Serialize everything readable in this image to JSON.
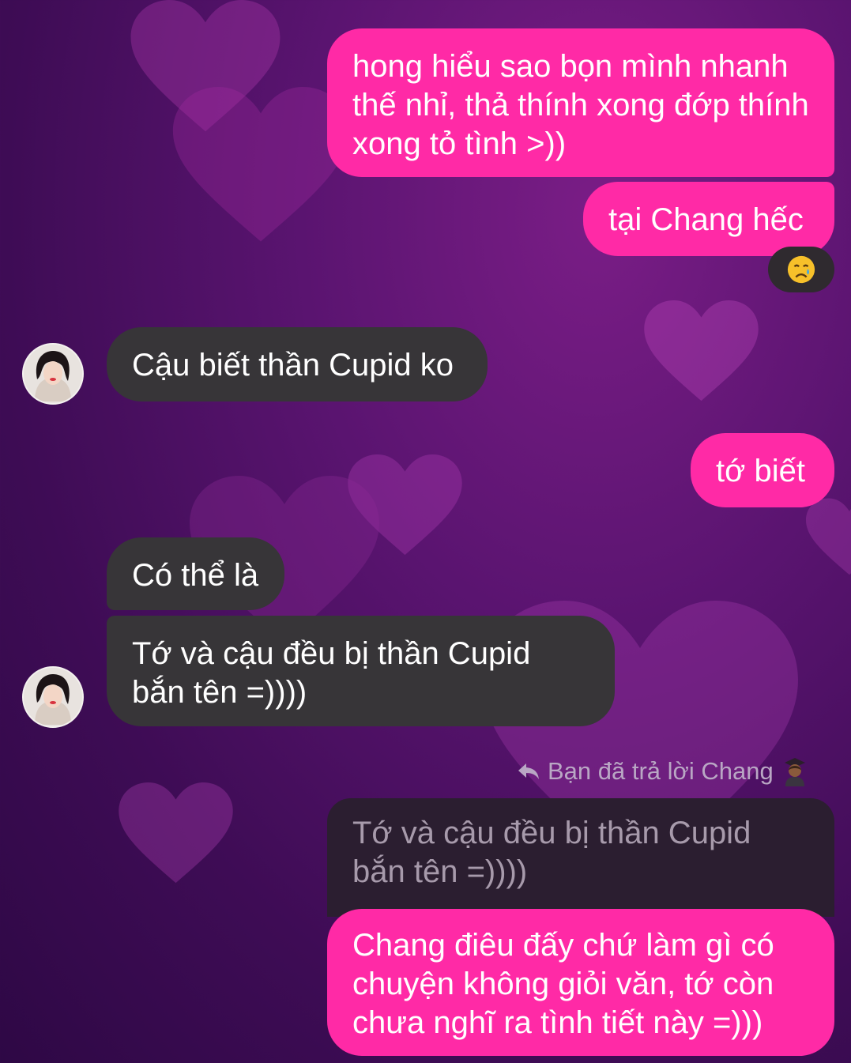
{
  "colors": {
    "outgoing_bubble": "#ff2aa6",
    "incoming_bubble": "#373538",
    "background": "#4a0f63"
  },
  "messages": [
    {
      "id": "m1",
      "direction": "outgoing",
      "text": "hong hiểu sao bọn mình nhanh thế nhỉ, thả thính xong đớp thính xong tỏ tình >))"
    },
    {
      "id": "m2",
      "direction": "outgoing",
      "text": "tại Chang hếc",
      "reaction": "crying-face"
    },
    {
      "id": "m3",
      "direction": "incoming",
      "text": "Cậu biết thần Cupid ko"
    },
    {
      "id": "m4",
      "direction": "outgoing",
      "text": "tớ biết"
    },
    {
      "id": "m5",
      "direction": "incoming",
      "text": "Có thể là"
    },
    {
      "id": "m6",
      "direction": "incoming",
      "text": "Tớ và cậu đều bị thần Cupid bắn tên =))))"
    },
    {
      "id": "m7",
      "direction": "outgoing",
      "text": "Chang điêu đấy chứ làm gì có chuyện không giỏi văn, tớ còn chưa nghĩ ra tình tiết này =)))"
    }
  ],
  "reply": {
    "label": "Bạn đã trả lời Chang",
    "icon": "reply-arrow-icon",
    "emoji": "person-emoji-icon",
    "quoted_text": "Tớ và cậu đều bị thần Cupid bắn tên =))))"
  }
}
